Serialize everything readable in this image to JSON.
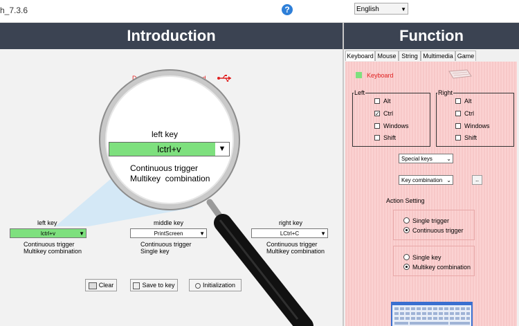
{
  "app": {
    "title": "h_7.3.6",
    "language": "English"
  },
  "intro": {
    "title": "Introduction",
    "device_status_part1": "Device St",
    "device_status_part2": "Found",
    "device_status_d": "D",
    "left_key": {
      "label": "left key",
      "value": "lctrl+v",
      "mode": "Continuous trigger",
      "combo": "Multikey  combination"
    },
    "middle_key": {
      "label": "middle key",
      "value": "PrintScreen",
      "mode": "Continuous trigger",
      "combo": "Single key"
    },
    "right_key": {
      "label": "right key",
      "value": "LCtrl+C",
      "mode": "Continuous trigger",
      "combo": "Multikey  combination"
    },
    "buttons": {
      "clear": "Clear",
      "save": "Save to key",
      "init": "Initialization"
    }
  },
  "magnifier": {
    "label": "left key",
    "value": "lctrl+v",
    "mode": "Continuous trigger",
    "combo": "Multikey  combination"
  },
  "function": {
    "title": "Function",
    "tabs": [
      "Keyboard",
      "Mouse",
      "String",
      "Multimedia",
      "Game"
    ],
    "active_tab": "Keyboard",
    "keyboard_label": "Keyboard",
    "left_group": {
      "title": "Left",
      "items": [
        "Alt",
        "Ctrl",
        "Windows",
        "Shift"
      ],
      "checked": [
        false,
        true,
        false,
        false
      ]
    },
    "right_group": {
      "title": "Right",
      "items": [
        "Alt",
        "Ctrl",
        "Windows",
        "Shift"
      ],
      "checked": [
        false,
        false,
        false,
        false
      ]
    },
    "special_keys": "Special keys",
    "key_combination": "Key combination",
    "ellipsis_button": "..",
    "action_setting": {
      "title": "Action Setting",
      "trigger_options": [
        "Single trigger",
        "Continuous trigger"
      ],
      "trigger_selected": 1,
      "key_options": [
        "Single key",
        "Multikey  combination"
      ],
      "key_selected": 1
    }
  },
  "colors": {
    "header_bg": "#3b4352",
    "accent_green": "#7ee07e",
    "status_red": "#e02020",
    "panel_pink": "#f7c8c8"
  }
}
